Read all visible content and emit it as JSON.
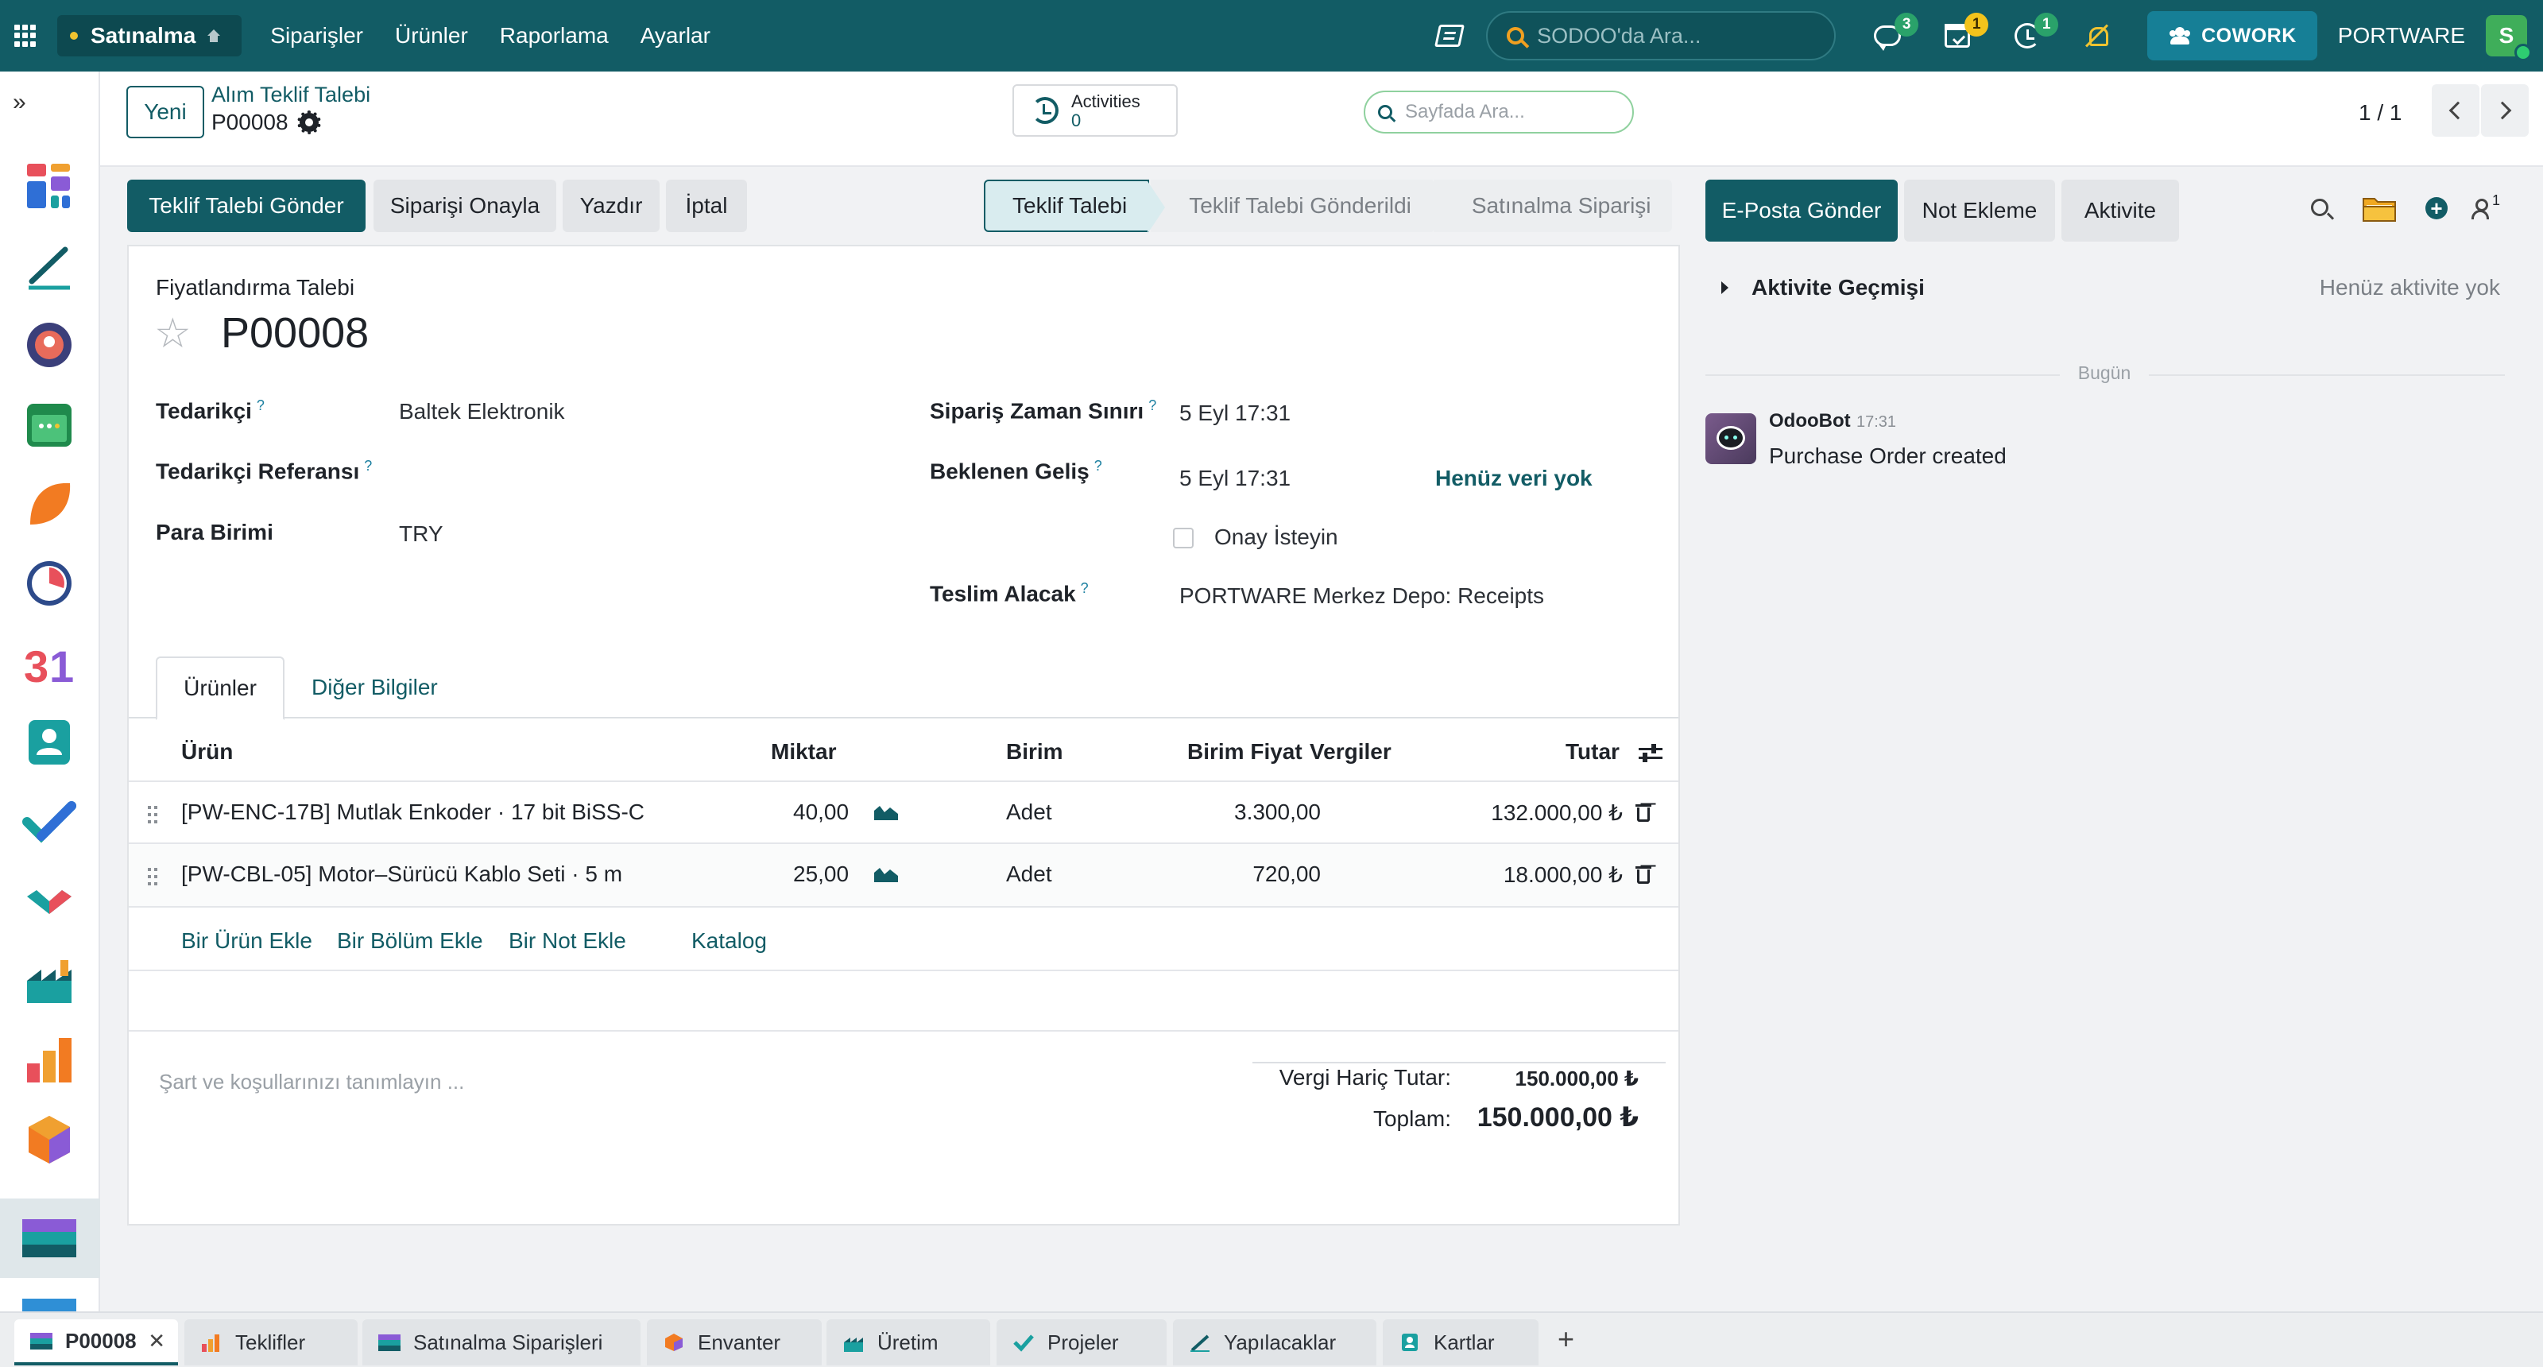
{
  "topnav": {
    "app_name": "Satınalma",
    "menu": [
      "Siparişler",
      "Ürünler",
      "Raporlama",
      "Ayarlar"
    ],
    "search_placeholder": "SODOO'da Ara...",
    "badges": {
      "messages": "3",
      "activities": "1",
      "timers": "1"
    },
    "cowork_label": "COWORK",
    "company": "PORTWARE",
    "avatar_letter": "S"
  },
  "control_panel": {
    "new_button": "Yeni",
    "breadcrumb_parent": "Alım Teklif Talebi",
    "breadcrumb_current": "P00008",
    "activities_label": "Activities",
    "activities_count": "0",
    "page_search_placeholder": "Sayfada Ara...",
    "pager": "1 / 1"
  },
  "actions": {
    "send_rfq": "Teklif Talebi Gönder",
    "confirm_order": "Siparişi Onayla",
    "print": "Yazdır",
    "cancel": "İptal"
  },
  "stages": [
    "Teklif Talebi",
    "Teklif Talebi Gönderildi",
    "Satınalma Siparişi"
  ],
  "form": {
    "type_label": "Fiyatlandırma Talebi",
    "name": "P00008",
    "fields": {
      "vendor_label": "Tedarikçi",
      "vendor_value": "Baltek Elektronik",
      "vendor_ref_label": "Tedarikçi Referansı",
      "currency_label": "Para Birimi",
      "currency_value": "TRY",
      "deadline_label": "Sipariş Zaman Sınırı",
      "deadline_value": "5 Eyl 17:31",
      "expected_label": "Beklenen Geliş",
      "expected_value": "5 Eyl 17:31",
      "no_data": "Henüz veri yok",
      "ask_confirm": "Onay İsteyin",
      "deliver_to_label": "Teslim Alacak",
      "deliver_to_value": "PORTWARE Merkez Depo: Receipts"
    },
    "tabs": [
      "Ürünler",
      "Diğer Bilgiler"
    ],
    "columns": {
      "product": "Ürün",
      "qty": "Miktar",
      "uom": "Birim",
      "price": "Birim Fiyat",
      "taxes": "Vergiler",
      "subtotal": "Tutar"
    },
    "lines": [
      {
        "product": "[PW-ENC-17B] Mutlak Enkoder · 17 bit BiSS-C",
        "qty": "40,00",
        "uom": "Adet",
        "price": "3.300,00",
        "taxes": "",
        "subtotal": "132.000,00 ₺"
      },
      {
        "product": "[PW-CBL-05] Motor–Sürücü Kablo Seti · 5 m",
        "qty": "25,00",
        "uom": "Adet",
        "price": "720,00",
        "taxes": "",
        "subtotal": "18.000,00 ₺"
      }
    ],
    "add_links": [
      "Bir Ürün Ekle",
      "Bir Bölüm Ekle",
      "Bir Not Ekle",
      "Katalog"
    ],
    "terms_placeholder": "Şart ve koşullarınızı tanımlayın ...",
    "untaxed_label": "Vergi Hariç Tutar:",
    "untaxed_value": "150.000,00 ₺",
    "total_label": "Toplam:",
    "total_value": "150.000,00 ₺"
  },
  "chatter": {
    "send_email": "E-Posta Gönder",
    "log_note": "Not Ekleme",
    "activity": "Aktivite",
    "follower_count": "1",
    "activity_history_title": "Aktivite Geçmişi",
    "activity_history_empty": "Henüz aktivite yok",
    "date_separator": "Bugün",
    "message": {
      "author": "OdooBot",
      "time": "17:31",
      "body": "Purchase Order created"
    }
  },
  "bottom_tabs": [
    {
      "label": "P00008",
      "icon": "purchase-icon",
      "active": true
    },
    {
      "label": "Teklifler",
      "icon": "sales-icon"
    },
    {
      "label": "Satınalma Siparişleri",
      "icon": "purchase-icon"
    },
    {
      "label": "Envanter",
      "icon": "inventory-icon"
    },
    {
      "label": "Üretim",
      "icon": "manufacturing-icon"
    },
    {
      "label": "Projeler",
      "icon": "project-icon"
    },
    {
      "label": "Yapılacaklar",
      "icon": "todo-icon"
    },
    {
      "label": "Kartlar",
      "icon": "contacts-icon"
    }
  ],
  "rail_icons": [
    "dashboard-icon",
    "pen-icon",
    "discuss-icon",
    "calendar-icon",
    "crm-icon",
    "timer-icon",
    "calendar-31-icon",
    "contacts-icon",
    "todo-check-icon",
    "sign-icon",
    "manufacturing-icon",
    "sales-report-icon",
    "inventory-icon",
    "purchase-icon",
    "email-icon"
  ],
  "colors": {
    "primary": "#125c65",
    "topbar": "#125c65",
    "accent_link": "#125c65",
    "badge_green": "#2aa26a",
    "badge_yellow": "#f3c31c"
  }
}
